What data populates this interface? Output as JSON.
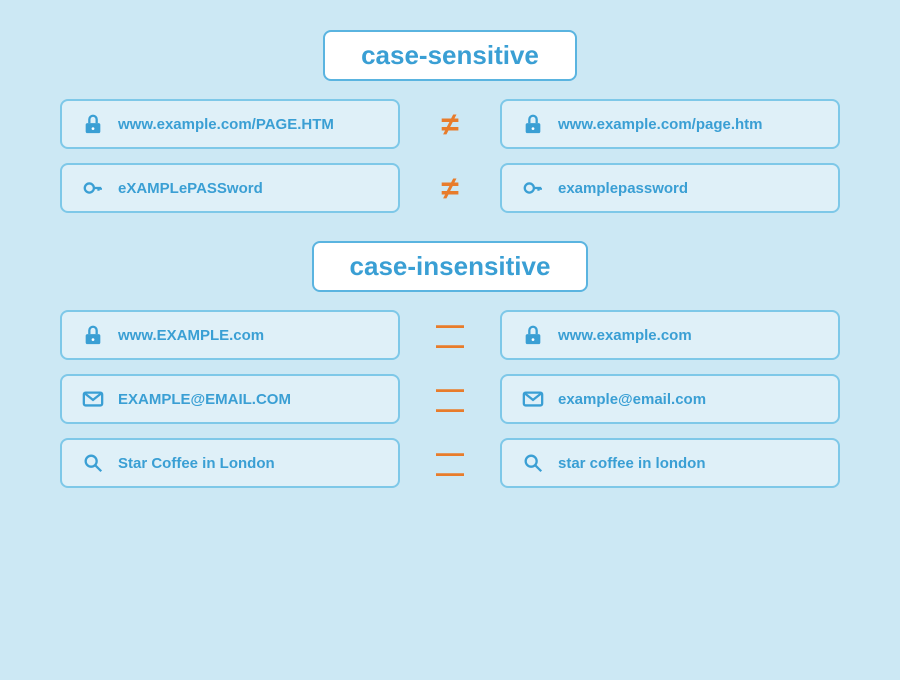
{
  "caseSensitive": {
    "label": "case-sensitive",
    "rows": [
      {
        "left": {
          "icon": "lock",
          "text": "www.example.com/PAGE.HTM"
        },
        "operator": "≠",
        "right": {
          "icon": "lock",
          "text": "www.example.com/page.htm"
        }
      },
      {
        "left": {
          "icon": "key",
          "text": "eXAMPLePASSword"
        },
        "operator": "≠",
        "right": {
          "icon": "key",
          "text": "examplepassword"
        }
      }
    ]
  },
  "caseInsensitive": {
    "label": "case-insensitive",
    "rows": [
      {
        "left": {
          "icon": "lock",
          "text": "www.EXAMPLE.com"
        },
        "operator": "=",
        "right": {
          "icon": "lock",
          "text": "www.example.com"
        }
      },
      {
        "left": {
          "icon": "envelope",
          "text": "EXAMPLE@EMAIL.COM"
        },
        "operator": "=",
        "right": {
          "icon": "envelope",
          "text": "example@email.com"
        }
      },
      {
        "left": {
          "icon": "search",
          "text": "Star Coffee in London"
        },
        "operator": "=",
        "right": {
          "icon": "search",
          "text": "star coffee in london"
        }
      }
    ]
  }
}
